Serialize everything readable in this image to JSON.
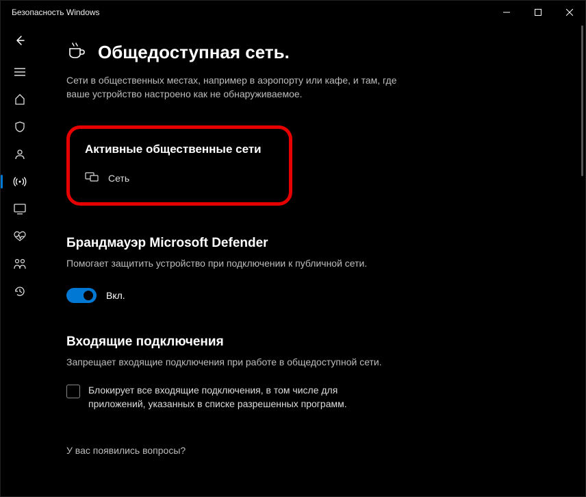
{
  "window": {
    "title": "Безопасность Windows"
  },
  "page": {
    "title": "Общедоступная сеть.",
    "subtitle": "Сети в общественных местах, например в аэропорту или кафе, и там, где ваше устройство настроено как не обнаруживаемое."
  },
  "active_networks": {
    "title": "Активные общественные сети",
    "item": "Сеть"
  },
  "firewall": {
    "title": "Брандмауэр Microsoft Defender",
    "desc": "Помогает защитить устройство при подключении к публичной сети.",
    "toggle_label": "Вкл."
  },
  "incoming": {
    "title": "Входящие подключения",
    "desc": "Запрещает входящие подключения при работе в общедоступной сети.",
    "checkbox_label": "Блокирует все входящие подключения, в том числе для приложений, указанных в списке разрешенных программ."
  },
  "help": {
    "title": "У вас появились вопросы?"
  }
}
